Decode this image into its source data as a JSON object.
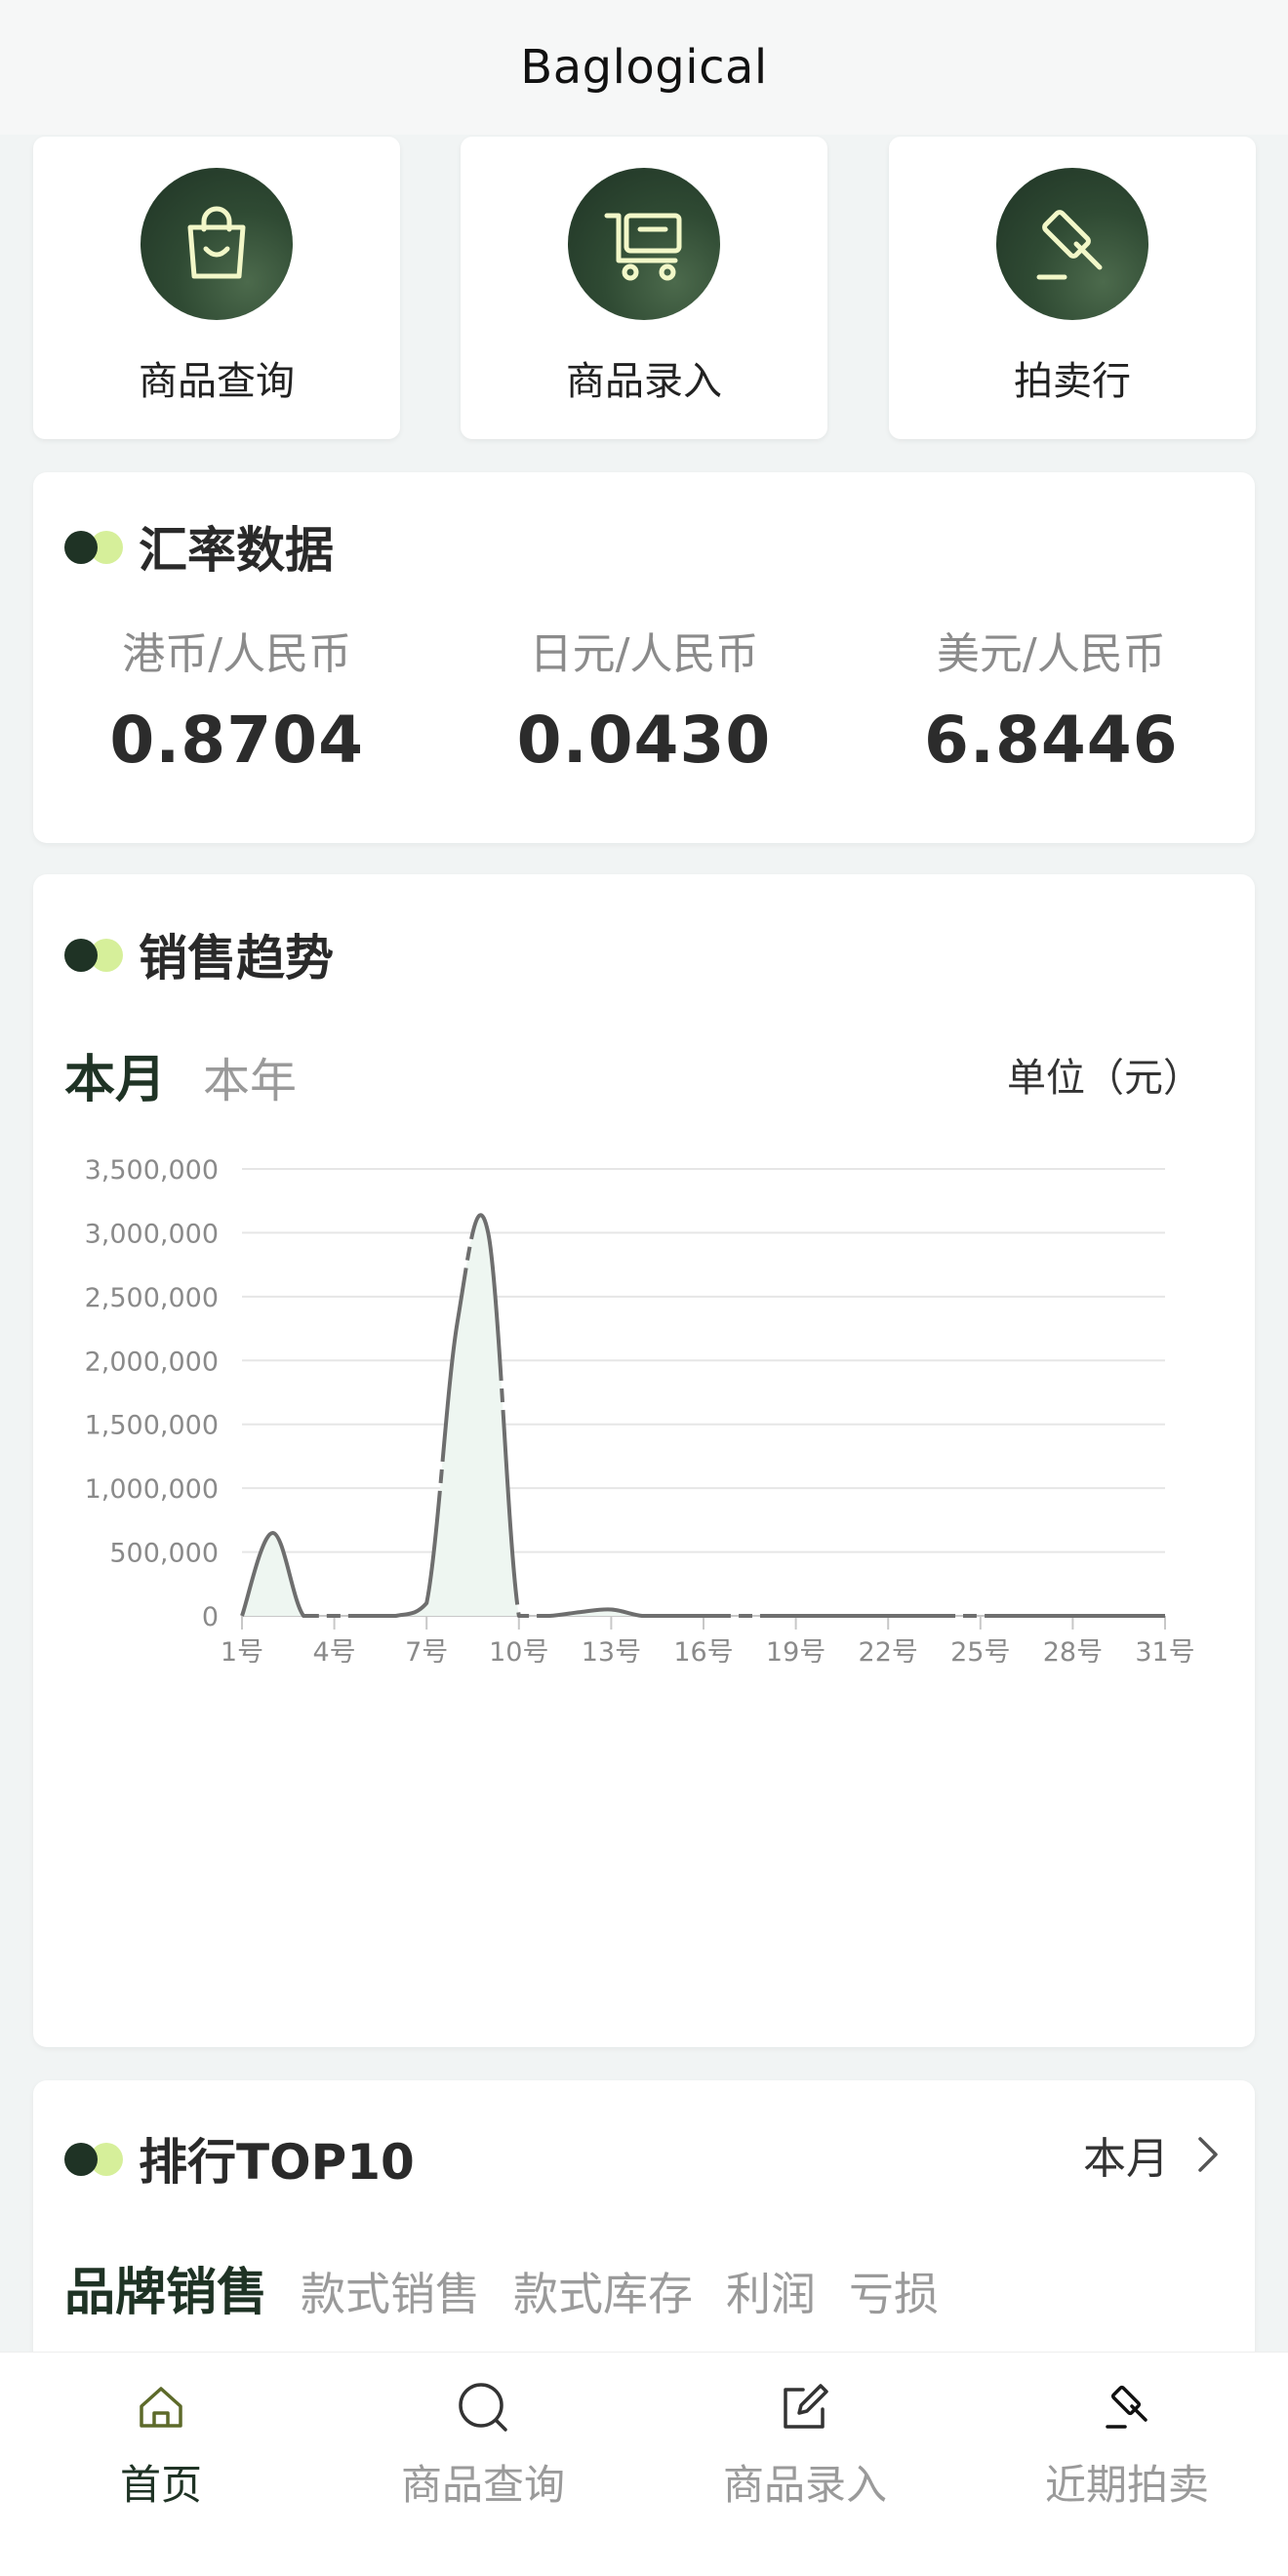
{
  "header": {
    "title": "Baglogical"
  },
  "tiles": [
    {
      "label": "商品查询",
      "icon": "shopping-bag-icon"
    },
    {
      "label": "商品录入",
      "icon": "cart-icon"
    },
    {
      "label": "拍卖行",
      "icon": "gavel-icon"
    }
  ],
  "exchange": {
    "title": "汇率数据",
    "rates": [
      {
        "label": "港币/人民币",
        "value": "0.8704"
      },
      {
        "label": "日元/人民币",
        "value": "0.0430"
      },
      {
        "label": "美元/人民币",
        "value": "6.8446"
      }
    ]
  },
  "sales": {
    "title": "销售趋势",
    "tabs": [
      "本月",
      "本年"
    ],
    "active_tab": 0,
    "unit": "单位（元）"
  },
  "chart_data": {
    "type": "area",
    "title": "",
    "xlabel": "",
    "ylabel": "",
    "ylim": [
      0,
      3500000
    ],
    "yticks": [
      0,
      500000,
      1000000,
      1500000,
      2000000,
      2500000,
      3000000,
      3500000
    ],
    "ytick_labels": [
      "0",
      "500,000",
      "1,000,000",
      "1,500,000",
      "2,000,000",
      "2,500,000",
      "3,000,000",
      "3,500,000"
    ],
    "xlim": [
      1,
      31
    ],
    "xticks": [
      1,
      4,
      7,
      10,
      13,
      16,
      19,
      22,
      25,
      28,
      31
    ],
    "xtick_labels": [
      "1号",
      "4号",
      "7号",
      "10号",
      "13号",
      "16号",
      "19号",
      "22号",
      "25号",
      "28号",
      "31号"
    ],
    "grid": true,
    "series": [
      {
        "x": [
          1,
          2,
          3,
          4,
          5,
          6,
          7,
          8,
          9,
          10,
          11,
          12,
          13,
          14,
          15,
          16,
          17,
          18,
          19,
          20,
          21,
          22,
          23,
          24,
          25,
          26,
          27,
          28,
          29,
          30,
          31
        ],
        "values": [
          0,
          650000,
          0,
          0,
          0,
          0,
          100000,
          2300000,
          3000000,
          0,
          0,
          30000,
          50000,
          0,
          0,
          0,
          0,
          0,
          0,
          0,
          0,
          0,
          0,
          0,
          0,
          0,
          0,
          0,
          0,
          0,
          0
        ]
      }
    ],
    "colors": {
      "line": "#6e6e6e",
      "fill": "#eef6f1",
      "grid": "#e6e6e6"
    }
  },
  "ranking": {
    "title": "排行TOP10",
    "period": "本月",
    "tabs": [
      "品牌销售",
      "款式销售",
      "款式库存",
      "利润",
      "亏损"
    ],
    "active_tab": 0
  },
  "bottom_nav": [
    {
      "label": "首页",
      "icon": "home-icon",
      "active": true
    },
    {
      "label": "商品查询",
      "icon": "search-icon",
      "active": false
    },
    {
      "label": "商品录入",
      "icon": "edit-icon",
      "active": false
    },
    {
      "label": "近期拍卖",
      "icon": "gavel-icon",
      "active": false
    }
  ],
  "colors": {
    "brand_dark": "#1f3325",
    "brand_light": "#d6ef9a",
    "background": "#f1f4f4"
  }
}
